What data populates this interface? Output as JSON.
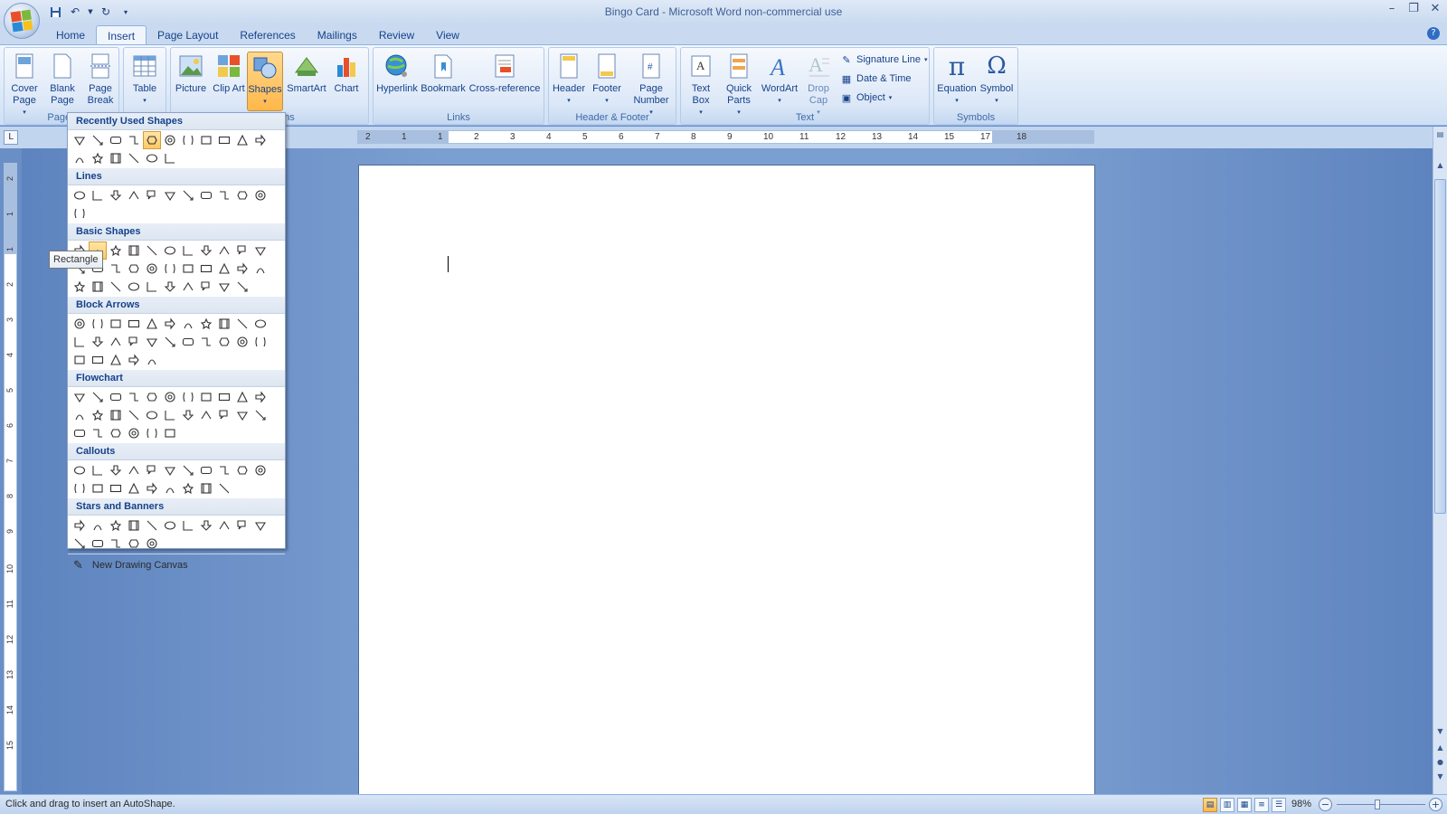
{
  "window": {
    "title": "Bingo Card - Microsoft Word non-commercial use"
  },
  "qat": {
    "icons": [
      "save-icon",
      "undo-icon",
      "redo-icon",
      "customize-icon"
    ]
  },
  "tabs": [
    {
      "label": "Home",
      "active": false
    },
    {
      "label": "Insert",
      "active": true
    },
    {
      "label": "Page Layout",
      "active": false
    },
    {
      "label": "References",
      "active": false
    },
    {
      "label": "Mailings",
      "active": false
    },
    {
      "label": "Review",
      "active": false
    },
    {
      "label": "View",
      "active": false
    }
  ],
  "ribbon": {
    "pages": {
      "label": "Pages",
      "cover_page": "Cover Page",
      "blank_page": "Blank Page",
      "page_break": "Page Break"
    },
    "tables": {
      "table": "Table"
    },
    "illustrations": {
      "label": "Illustrations",
      "picture": "Picture",
      "clip_art": "Clip Art",
      "shapes": "Shapes",
      "smartart": "SmartArt",
      "chart": "Chart"
    },
    "links": {
      "label": "Links",
      "hyperlink": "Hyperlink",
      "bookmark": "Bookmark",
      "cross_reference": "Cross-reference"
    },
    "header_footer": {
      "label": "Header & Footer",
      "header": "Header",
      "footer": "Footer",
      "page_number": "Page Number"
    },
    "text": {
      "label": "Text",
      "text_box": "Text Box",
      "quick_parts": "Quick Parts",
      "wordart": "WordArt",
      "drop_cap": "Drop Cap",
      "signature_line": "Signature Line",
      "date_time": "Date & Time",
      "object": "Object"
    },
    "symbols": {
      "label": "Symbols",
      "equation": "Equation",
      "symbol": "Symbol"
    }
  },
  "shapes_menu": {
    "sections": [
      {
        "title": "Recently Used Shapes",
        "count": 17,
        "selected_index": 4
      },
      {
        "title": "Lines",
        "count": 12
      },
      {
        "title": "Basic Shapes",
        "count": 32,
        "selected_index": 1
      },
      {
        "title": "Block Arrows",
        "count": 27
      },
      {
        "title": "Flowchart",
        "count": 28
      },
      {
        "title": "Callouts",
        "count": 20
      },
      {
        "title": "Stars and Banners",
        "count": 16
      }
    ],
    "new_drawing_canvas": "New Drawing Canvas"
  },
  "tooltip": "Rectangle",
  "ruler": {
    "h_numbers": [
      "2",
      "1",
      "1",
      "2",
      "3",
      "4",
      "5",
      "6",
      "7",
      "8",
      "9",
      "10",
      "11",
      "12",
      "13",
      "14",
      "15",
      "17",
      "18"
    ],
    "v_numbers": [
      "2",
      "1",
      "1",
      "2",
      "3",
      "4",
      "5",
      "6",
      "7",
      "8",
      "9",
      "10",
      "11",
      "12",
      "13",
      "14",
      "15"
    ]
  },
  "status": {
    "text": "Click and drag to insert an AutoShape.",
    "zoom": "98%"
  },
  "colors": {
    "ribbon_accent": "#15428b",
    "pressed": "#ffb74a",
    "workspace": "#6a8fc6"
  }
}
